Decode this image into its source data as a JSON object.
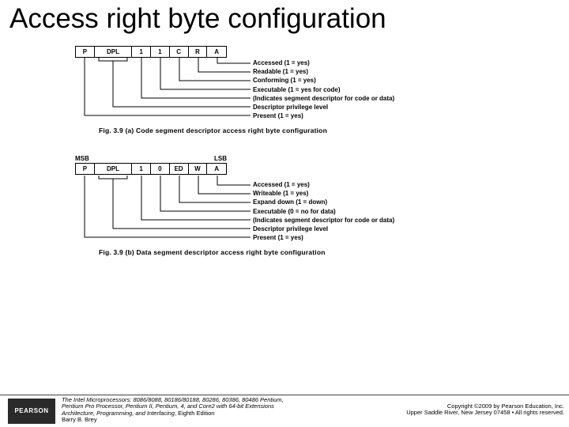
{
  "title": "Access right byte configuration",
  "fig_a": {
    "bits": {
      "p": "P",
      "dpl": "DPL",
      "b1": "1",
      "b2": "1",
      "c": "C",
      "r": "R",
      "a": "A"
    },
    "desc": [
      "Accessed (1 = yes)",
      "Readable (1 = yes)",
      "Conforming (1 = yes)",
      "Executable (1 = yes for code)",
      "(Indicates segment descriptor for code or data)",
      "Descriptor privilege level",
      "Present (1 = yes)"
    ],
    "caption": "Fig. 3.9 (a) Code segment descriptor access right byte configuration"
  },
  "fig_b": {
    "msb": "MSB",
    "lsb": "LSB",
    "bits": {
      "p": "P",
      "dpl": "DPL",
      "b1": "1",
      "b2": "0",
      "ed": "ED",
      "w": "W",
      "a": "A"
    },
    "desc": [
      "Accessed (1 = yes)",
      "Writeable (1 = yes)",
      "Expand down (1 = down)",
      "Executable (0 = no for data)",
      "(Indicates segment descriptor for code or data)",
      "Descriptor privilege level",
      "Present (1 = yes)"
    ],
    "caption": "Fig. 3.9 (b) Data segment descriptor access right byte configuration"
  },
  "footer": {
    "logo": "PEARSON",
    "book1": "The Intel Microprocessors: 8086/8088, 80186/80188, 80286, 80386, 80486 Pentium,",
    "book2": "Pentium Pro Processor, Pentium II, Pentium, 4, and Core2 with 64-bit Extensions",
    "book3": "Architecture, Programming, and Interfacing",
    "book3b": ", Eighth Edition",
    "author": "Barry B. Brey",
    "copy1": "Copyright ©2009 by Pearson Education, Inc.",
    "copy2": "Upper Saddle River, New Jersey 07458 • All rights reserved."
  }
}
